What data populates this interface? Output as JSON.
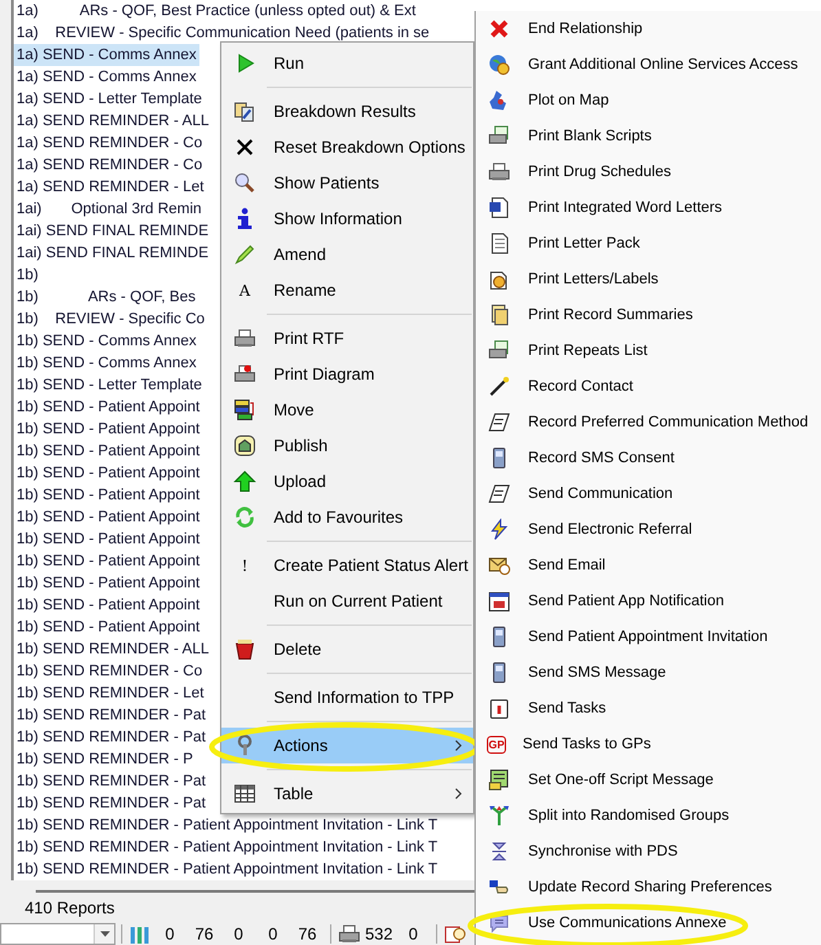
{
  "list": {
    "rows": [
      {
        "text": "1a)          ARs - QOF, Best Practice (unless opted out) & Ext",
        "selected": false
      },
      {
        "text": "1a)    REVIEW - Specific Communication Need (patients in se",
        "selected": false
      },
      {
        "text": "1a) SEND - Comms Annex",
        "selected": true
      },
      {
        "text": "1a) SEND - Comms Annex",
        "selected": false
      },
      {
        "text": "1a) SEND - Letter Template",
        "selected": false
      },
      {
        "text": "1a) SEND REMINDER - ALL",
        "selected": false
      },
      {
        "text": "1a) SEND REMINDER - Co",
        "selected": false
      },
      {
        "text": "1a) SEND REMINDER - Co",
        "selected": false
      },
      {
        "text": "1a) SEND REMINDER - Let",
        "selected": false
      },
      {
        "text": "1ai)       Optional 3rd Remin",
        "selected": false
      },
      {
        "text": "1ai) SEND FINAL REMINDE",
        "selected": false
      },
      {
        "text": "1ai) SEND FINAL REMINDE",
        "selected": false
      },
      {
        "text": "1b)",
        "selected": false
      },
      {
        "text": "1b)            ARs - QOF, Bes",
        "selected": false
      },
      {
        "text": "1b)    REVIEW - Specific Co",
        "selected": false
      },
      {
        "text": "1b) SEND - Comms Annex",
        "selected": false
      },
      {
        "text": "1b) SEND - Comms Annex",
        "selected": false
      },
      {
        "text": "1b) SEND - Letter Template",
        "selected": false
      },
      {
        "text": "1b) SEND - Patient Appoint",
        "selected": false
      },
      {
        "text": "1b) SEND - Patient Appoint",
        "selected": false
      },
      {
        "text": "1b) SEND - Patient Appoint",
        "selected": false
      },
      {
        "text": "1b) SEND - Patient Appoint",
        "selected": false
      },
      {
        "text": "1b) SEND - Patient Appoint",
        "selected": false
      },
      {
        "text": "1b) SEND - Patient Appoint",
        "selected": false
      },
      {
        "text": "1b) SEND - Patient Appoint",
        "selected": false
      },
      {
        "text": "1b) SEND - Patient Appoint",
        "selected": false
      },
      {
        "text": "1b) SEND - Patient Appoint",
        "selected": false
      },
      {
        "text": "1b) SEND - Patient Appoint",
        "selected": false
      },
      {
        "text": "1b) SEND - Patient Appoint",
        "selected": false
      },
      {
        "text": "1b) SEND REMINDER - ALL",
        "selected": false
      },
      {
        "text": "1b) SEND REMINDER - Co",
        "selected": false
      },
      {
        "text": "1b) SEND REMINDER - Let",
        "selected": false
      },
      {
        "text": "1b) SEND REMINDER - Pat",
        "selected": false
      },
      {
        "text": "1b) SEND REMINDER - Pat",
        "selected": false
      },
      {
        "text": "1b) SEND REMINDER - P",
        "selected": false
      },
      {
        "text": "1b) SEND REMINDER - Pat",
        "selected": false
      },
      {
        "text": "1b) SEND REMINDER - Pat",
        "selected": false
      },
      {
        "text": "1b) SEND REMINDER - Patient Appointment Invitation - Link T",
        "selected": false
      },
      {
        "text": "1b) SEND REMINDER - Patient Appointment Invitation - Link T",
        "selected": false
      },
      {
        "text": "1b) SEND REMINDER - Patient Appointment Invitation - Link T",
        "selected": false
      }
    ]
  },
  "status": {
    "count": "410 Reports",
    "counts_a": [
      "0",
      "76",
      "0",
      "0",
      "76"
    ],
    "counts_b": [
      "532",
      "0"
    ]
  },
  "context_menu": {
    "items": [
      {
        "kind": "item",
        "label": "Run",
        "selected": false,
        "has_submenu": false,
        "circled": false
      },
      {
        "kind": "separator"
      },
      {
        "kind": "item",
        "label": "Breakdown Results",
        "selected": false,
        "has_submenu": false,
        "circled": false
      },
      {
        "kind": "item",
        "label": "Reset Breakdown Options",
        "selected": false,
        "has_submenu": false,
        "circled": false
      },
      {
        "kind": "item",
        "label": "Show Patients",
        "selected": false,
        "has_submenu": false,
        "circled": false
      },
      {
        "kind": "item",
        "label": "Show Information",
        "selected": false,
        "has_submenu": false,
        "circled": false
      },
      {
        "kind": "item",
        "label": "Amend",
        "selected": false,
        "has_submenu": false,
        "circled": false
      },
      {
        "kind": "item",
        "label": "Rename",
        "glyph": "A",
        "selected": false,
        "has_submenu": false,
        "circled": false
      },
      {
        "kind": "separator"
      },
      {
        "kind": "item",
        "label": "Print RTF",
        "selected": false,
        "has_submenu": false,
        "circled": false
      },
      {
        "kind": "item",
        "label": "Print Diagram",
        "selected": false,
        "has_submenu": false,
        "circled": false
      },
      {
        "kind": "item",
        "label": "Move",
        "selected": false,
        "has_submenu": false,
        "circled": false
      },
      {
        "kind": "item",
        "label": "Publish",
        "selected": false,
        "has_submenu": false,
        "circled": false
      },
      {
        "kind": "item",
        "label": "Upload",
        "selected": false,
        "has_submenu": false,
        "circled": false
      },
      {
        "kind": "item",
        "label": "Add to Favourites",
        "selected": false,
        "has_submenu": false,
        "circled": false
      },
      {
        "kind": "separator"
      },
      {
        "kind": "item",
        "label": "Create Patient Status Alert",
        "glyph": "!",
        "selected": false,
        "has_submenu": false,
        "circled": false
      },
      {
        "kind": "item",
        "label": "Run on Current Patient",
        "selected": false,
        "has_submenu": false,
        "circled": false
      },
      {
        "kind": "separator"
      },
      {
        "kind": "item",
        "label": "Delete",
        "selected": false,
        "has_submenu": false,
        "circled": false
      },
      {
        "kind": "separator"
      },
      {
        "kind": "item",
        "label": "Send Information to TPP",
        "selected": false,
        "has_submenu": false,
        "circled": false
      },
      {
        "kind": "separator"
      },
      {
        "kind": "item",
        "label": "Actions",
        "selected": true,
        "has_submenu": true,
        "circled": true
      },
      {
        "kind": "separator"
      },
      {
        "kind": "item",
        "label": "Table",
        "selected": false,
        "has_submenu": true,
        "circled": false
      }
    ]
  },
  "submenu": {
    "items": [
      {
        "label": "End Relationship",
        "selected": false,
        "circled": false
      },
      {
        "label": "Grant Additional Online Services Access",
        "selected": false,
        "circled": false
      },
      {
        "label": "Plot on Map",
        "selected": false,
        "circled": false
      },
      {
        "label": "Print Blank Scripts",
        "selected": false,
        "circled": false
      },
      {
        "label": "Print Drug Schedules",
        "selected": false,
        "circled": false
      },
      {
        "label": "Print Integrated Word Letters",
        "selected": false,
        "circled": false
      },
      {
        "label": "Print Letter Pack",
        "selected": false,
        "circled": false
      },
      {
        "label": "Print Letters/Labels",
        "selected": false,
        "circled": false
      },
      {
        "label": "Print Record Summaries",
        "selected": false,
        "circled": false
      },
      {
        "label": "Print Repeats List",
        "selected": false,
        "circled": false
      },
      {
        "label": "Record Contact",
        "selected": false,
        "circled": false
      },
      {
        "label": "Record Preferred Communication Method",
        "selected": false,
        "circled": false
      },
      {
        "label": "Record SMS Consent",
        "selected": false,
        "circled": false
      },
      {
        "label": "Send Communication",
        "selected": false,
        "circled": false
      },
      {
        "label": "Send Electronic Referral",
        "selected": false,
        "circled": false
      },
      {
        "label": "Send Email",
        "selected": false,
        "circled": false
      },
      {
        "label": "Send Patient App Notification",
        "selected": false,
        "circled": false
      },
      {
        "label": "Send Patient Appointment Invitation",
        "selected": false,
        "circled": false
      },
      {
        "label": "Send SMS Message",
        "selected": false,
        "circled": false
      },
      {
        "label": "Send Tasks",
        "selected": false,
        "circled": false
      },
      {
        "label": "Send Tasks to GPs",
        "glyph": "GP",
        "selected": false,
        "circled": false
      },
      {
        "label": "Set One-off Script Message",
        "selected": false,
        "circled": false
      },
      {
        "label": "Split into Randomised Groups",
        "selected": false,
        "circled": false
      },
      {
        "label": "Synchronise with PDS",
        "selected": false,
        "circled": false
      },
      {
        "label": "Update Record Sharing Preferences",
        "selected": false,
        "circled": false
      },
      {
        "label": "Use Communications Annexe",
        "selected": false,
        "circled": true
      }
    ]
  }
}
